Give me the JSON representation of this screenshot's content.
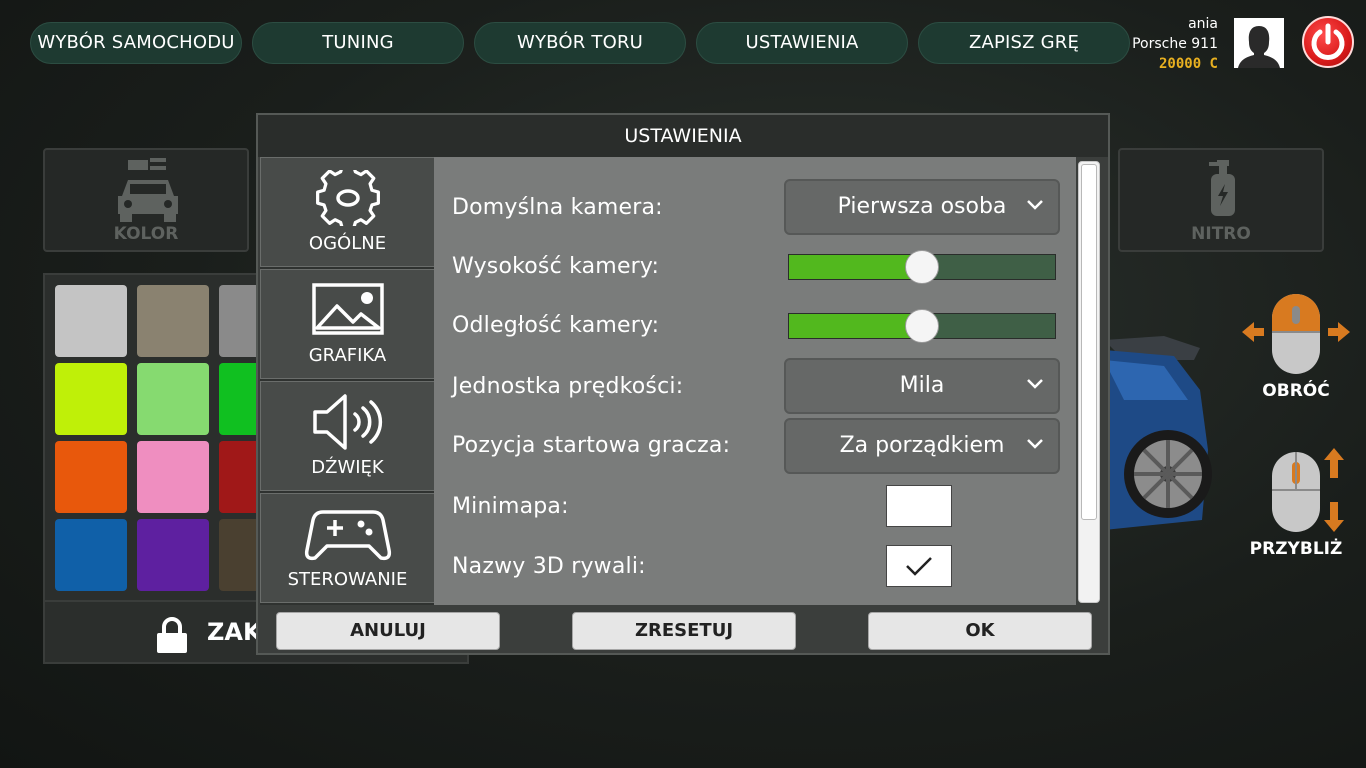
{
  "nav": {
    "items": [
      {
        "label": "WYBÓR SAMOCHODU"
      },
      {
        "label": "TUNING"
      },
      {
        "label": "WYBÓR TORU"
      },
      {
        "label": "USTAWIENIA"
      },
      {
        "label": "ZAPISZ GRĘ"
      }
    ]
  },
  "user": {
    "name": "ania",
    "car": "Porsche 911",
    "credits": "20000 C"
  },
  "side": {
    "kolor_label": "KOLOR",
    "nitro_label": "NITRO",
    "buy_label": "ZAKUPIONY",
    "rotate_label": "OBRÓĆ",
    "zoom_label": "PRZYBLIŻ"
  },
  "swatches": [
    "#c4c4c4",
    "#8a8270",
    "#8a8a8a",
    "#bff008",
    "#86da70",
    "#10c020",
    "#e8580c",
    "#ef8ec0",
    "#a01818",
    "#1060a8",
    "#5e20a0",
    "#4a4030"
  ],
  "dialog": {
    "title": "USTAWIENIA",
    "tabs": [
      {
        "label": "OGÓLNE",
        "icon": "gear-icon"
      },
      {
        "label": "GRAFIKA",
        "icon": "image-icon"
      },
      {
        "label": "DŹWIĘK",
        "icon": "speaker-icon"
      },
      {
        "label": "STEROWANIE",
        "icon": "gamepad-icon"
      }
    ],
    "settings": {
      "camera_label": "Domyślna kamera:",
      "camera_value": "Pierwsza osoba",
      "height_label": "Wysokość kamery:",
      "height_value": 0.5,
      "distance_label": "Odległość kamery:",
      "distance_value": 0.5,
      "speed_unit_label": "Jednostka prędkości:",
      "speed_unit_value": "Mila",
      "start_pos_label": "Pozycja startowa gracza:",
      "start_pos_value": "Za porządkiem",
      "minimap_label": "Minimapa:",
      "minimap_checked": false,
      "rivals_label": "Nazwy 3D rywali:",
      "rivals_checked": true
    },
    "buttons": {
      "cancel": "ANULUJ",
      "reset": "ZRESETUJ",
      "ok": "OK"
    }
  },
  "colors": {
    "nav_bg": "#1e3a31",
    "slider_fill": "#52b81e",
    "power": "#d91a1a",
    "credits": "#e8b020"
  }
}
